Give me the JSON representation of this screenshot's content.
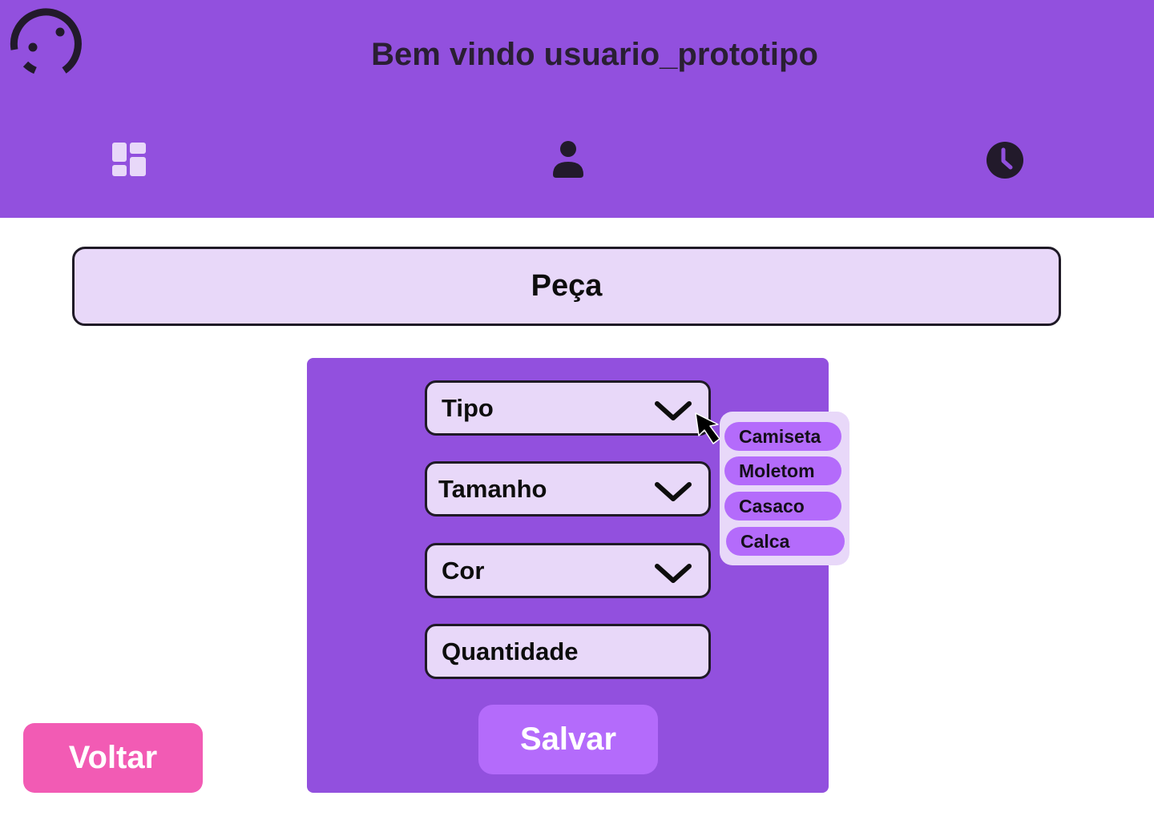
{
  "colors": {
    "brand_purple": "#9250de",
    "light_lavender": "#e8d8f9",
    "accent_purple": "#b46bfb",
    "back_pink": "#f25bb4",
    "dark_text": "#2a1f33"
  },
  "header": {
    "logo_icon": "smiley-logo-icon",
    "welcome_text": "Bem vindo usuario_prototipo",
    "nav": [
      {
        "icon": "dashboard-icon",
        "state": "active"
      },
      {
        "icon": "user-icon",
        "state": "inactive"
      },
      {
        "icon": "clock-icon",
        "state": "inactive"
      }
    ]
  },
  "page": {
    "title": "Peça"
  },
  "form": {
    "fields": {
      "tipo": {
        "label": "Tipo",
        "type": "select",
        "icon": "chevron-down-icon",
        "expanded": true
      },
      "tamanho": {
        "label": "Tamanho",
        "type": "select",
        "icon": "chevron-down-icon"
      },
      "cor": {
        "label": "Cor",
        "type": "select",
        "icon": "chevron-down-icon"
      },
      "quantidade": {
        "label": "Quantidade",
        "type": "input"
      }
    },
    "tipo_options": [
      "Camiseta",
      "Moletom",
      "Casaco",
      "Calca"
    ],
    "save_label": "Salvar"
  },
  "footer": {
    "back_label": "Voltar"
  }
}
